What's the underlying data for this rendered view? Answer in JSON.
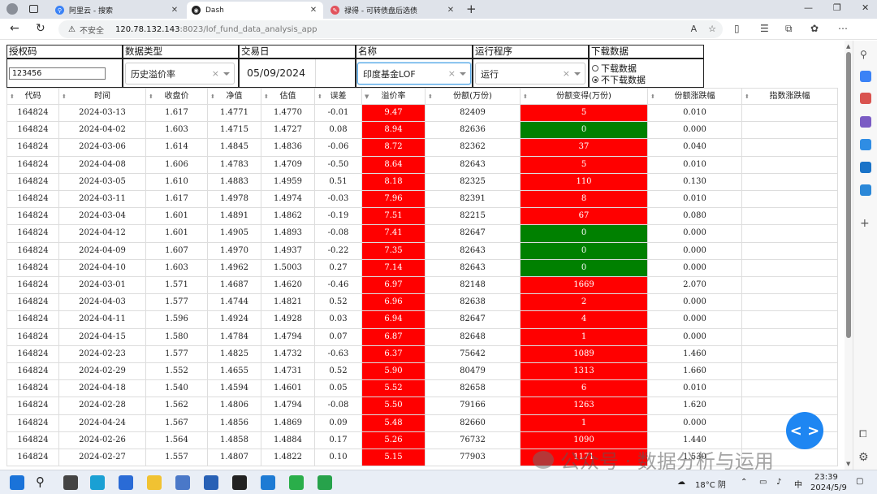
{
  "browser": {
    "tabs": [
      {
        "title": "阿里云 - 搜索",
        "fav_color": "#3b82f6"
      },
      {
        "title": "Dash",
        "fav_color": "#222222"
      },
      {
        "title": "禄得 - 可转债盘后选债",
        "fav_color": "#e2525c"
      }
    ],
    "close_glyph": "✕",
    "new_tab": "+",
    "url_insecure": "不安全",
    "url_host": "120.78.132.143",
    "url_path": ":8023/lof_fund_data_analysis_app"
  },
  "form": {
    "auth_label": "授权码",
    "auth_value": "123456",
    "datatype_label": "数据类型",
    "datatype_value": "历史溢价率",
    "date_label": "交易日",
    "date_value": "05/09/2024",
    "name_label": "名称",
    "name_value": "印度基金LOF",
    "program_label": "运行程序",
    "program_value": "运行",
    "download_label": "下载数据",
    "download_options": [
      "下载数据",
      "不下载数据"
    ],
    "download_selected": 1
  },
  "table": {
    "columns": [
      "代码",
      "时间",
      "收盘价",
      "净值",
      "估值",
      "误差",
      "溢价率",
      "份额(万份)",
      "份额变得(万份)",
      "份额涨跌幅",
      "指数涨跌幅"
    ],
    "rows": [
      [
        "164824",
        "2024-03-13",
        "1.617",
        "1.4771",
        "1.4770",
        "-0.01",
        "9.47",
        "82409",
        "5",
        "0.010",
        ""
      ],
      [
        "164824",
        "2024-04-02",
        "1.603",
        "1.4715",
        "1.4727",
        "0.08",
        "8.94",
        "82636",
        "0",
        "0.000",
        ""
      ],
      [
        "164824",
        "2024-03-06",
        "1.614",
        "1.4845",
        "1.4836",
        "-0.06",
        "8.72",
        "82362",
        "37",
        "0.040",
        ""
      ],
      [
        "164824",
        "2024-04-08",
        "1.606",
        "1.4783",
        "1.4709",
        "-0.50",
        "8.64",
        "82643",
        "5",
        "0.010",
        ""
      ],
      [
        "164824",
        "2024-03-05",
        "1.610",
        "1.4883",
        "1.4959",
        "0.51",
        "8.18",
        "82325",
        "110",
        "0.130",
        ""
      ],
      [
        "164824",
        "2024-03-11",
        "1.617",
        "1.4978",
        "1.4974",
        "-0.03",
        "7.96",
        "82391",
        "8",
        "0.010",
        ""
      ],
      [
        "164824",
        "2024-03-04",
        "1.601",
        "1.4891",
        "1.4862",
        "-0.19",
        "7.51",
        "82215",
        "67",
        "0.080",
        ""
      ],
      [
        "164824",
        "2024-04-12",
        "1.601",
        "1.4905",
        "1.4893",
        "-0.08",
        "7.41",
        "82647",
        "0",
        "0.000",
        ""
      ],
      [
        "164824",
        "2024-04-09",
        "1.607",
        "1.4970",
        "1.4937",
        "-0.22",
        "7.35",
        "82643",
        "0",
        "0.000",
        ""
      ],
      [
        "164824",
        "2024-04-10",
        "1.603",
        "1.4962",
        "1.5003",
        "0.27",
        "7.14",
        "82643",
        "0",
        "0.000",
        ""
      ],
      [
        "164824",
        "2024-03-01",
        "1.571",
        "1.4687",
        "1.4620",
        "-0.46",
        "6.97",
        "82148",
        "1669",
        "2.070",
        ""
      ],
      [
        "164824",
        "2024-04-03",
        "1.577",
        "1.4744",
        "1.4821",
        "0.52",
        "6.96",
        "82638",
        "2",
        "0.000",
        ""
      ],
      [
        "164824",
        "2024-04-11",
        "1.596",
        "1.4924",
        "1.4928",
        "0.03",
        "6.94",
        "82647",
        "4",
        "0.000",
        ""
      ],
      [
        "164824",
        "2024-04-15",
        "1.580",
        "1.4784",
        "1.4794",
        "0.07",
        "6.87",
        "82648",
        "1",
        "0.000",
        ""
      ],
      [
        "164824",
        "2024-02-23",
        "1.577",
        "1.4825",
        "1.4732",
        "-0.63",
        "6.37",
        "75642",
        "1089",
        "1.460",
        ""
      ],
      [
        "164824",
        "2024-02-29",
        "1.552",
        "1.4655",
        "1.4731",
        "0.52",
        "5.90",
        "80479",
        "1313",
        "1.660",
        ""
      ],
      [
        "164824",
        "2024-04-18",
        "1.540",
        "1.4594",
        "1.4601",
        "0.05",
        "5.52",
        "82658",
        "6",
        "0.010",
        ""
      ],
      [
        "164824",
        "2024-02-28",
        "1.562",
        "1.4806",
        "1.4794",
        "-0.08",
        "5.50",
        "79166",
        "1263",
        "1.620",
        ""
      ],
      [
        "164824",
        "2024-04-24",
        "1.567",
        "1.4856",
        "1.4869",
        "0.09",
        "5.48",
        "82660",
        "1",
        "0.000",
        ""
      ],
      [
        "164824",
        "2024-02-26",
        "1.564",
        "1.4858",
        "1.4884",
        "0.17",
        "5.26",
        "76732",
        "1090",
        "1.440",
        ""
      ],
      [
        "164824",
        "2024-02-27",
        "1.557",
        "1.4807",
        "1.4822",
        "0.10",
        "5.15",
        "77903",
        "1171",
        "1.530",
        ""
      ]
    ],
    "change_zero_green": true
  },
  "overlay": {
    "fab_label": "< >",
    "watermark": "公众号 · 数据分析与运用"
  },
  "taskbar": {
    "weather": "18°C 阴",
    "lang": "中",
    "time": "23:39",
    "date": "2024/5/9"
  },
  "colors": {
    "red": "#ff0000",
    "green": "#008000",
    "accent": "#1e86f2"
  }
}
